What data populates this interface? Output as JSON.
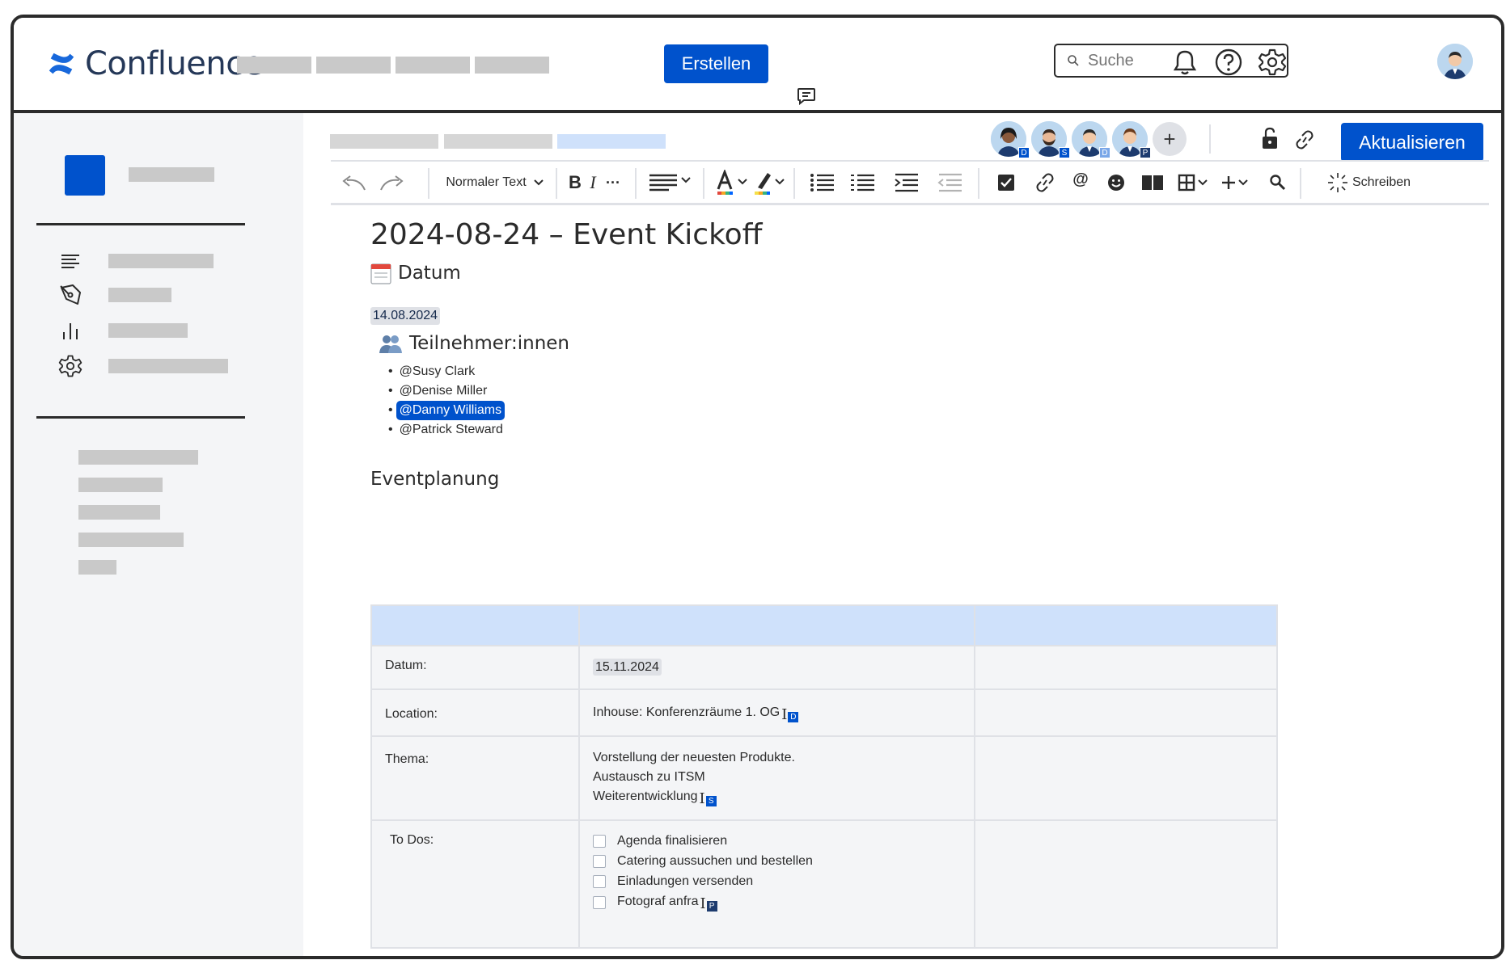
{
  "app": {
    "name": "Confluence"
  },
  "header": {
    "create_label": "Erstellen",
    "search_placeholder": "Suche"
  },
  "toolbar": {
    "text_style": "Normaler Text",
    "write_label": "Schreiben",
    "update_label": "Aktualisieren"
  },
  "collaborators": [
    {
      "initial": "D"
    },
    {
      "initial": "S"
    },
    {
      "initial": "D"
    },
    {
      "initial": "P"
    }
  ],
  "page": {
    "title": "2024-08-24 – Event Kickoff",
    "date_heading": "Datum",
    "date_value": "14.08.2024",
    "participants_heading": "Teilnehmer:innen",
    "participants": [
      "@Susy Clark",
      "@Denise Miller",
      "@Danny Williams",
      "@Patrick Steward"
    ],
    "planning_heading": "Eventplanung"
  },
  "table": {
    "rows": [
      {
        "label": "Datum:",
        "value": "15.11.2024"
      },
      {
        "label": "Location:",
        "value": "Inhouse: Konferenzräume 1. OG",
        "cursor": "D"
      },
      {
        "label": "Thema:",
        "lines": [
          "Vorstellung der neuesten Produkte.",
          "Austausch zu ITSM",
          "Weiterentwicklung"
        ],
        "cursor": "S"
      },
      {
        "label": "To Dos:",
        "todos": [
          "Agenda finalisieren",
          "Catering aussuchen und bestellen",
          "Einladungen versenden",
          "Fotograf anfra"
        ],
        "cursor": "P"
      }
    ]
  },
  "colors": {
    "brand": "#0052cc",
    "selection": "#cfe1fb",
    "placeholder": "#c9c9c9"
  }
}
